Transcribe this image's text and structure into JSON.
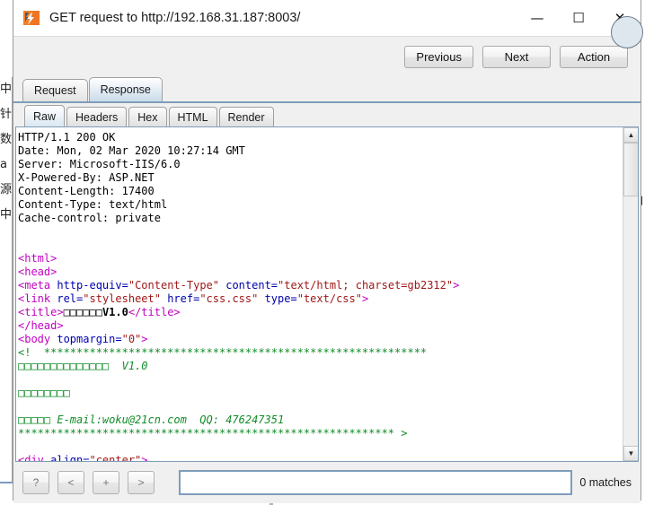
{
  "window": {
    "title": "GET request to http://192.168.31.187:8003/",
    "icon": "burp-suite-icon",
    "minimize": "—",
    "maximize": "☐",
    "close": "✕"
  },
  "toolbar": {
    "previous_label": "Previous",
    "next_label": "Next",
    "action_label": "Action"
  },
  "tabs": [
    {
      "label": "Request",
      "active": false
    },
    {
      "label": "Response",
      "active": true
    }
  ],
  "subtabs": [
    {
      "label": "Raw",
      "active": true
    },
    {
      "label": "Headers",
      "active": false
    },
    {
      "label": "Hex",
      "active": false
    },
    {
      "label": "HTML",
      "active": false
    },
    {
      "label": "Render",
      "active": false
    }
  ],
  "response": {
    "status_line": "HTTP/1.1 200 OK",
    "headers": [
      "Date: Mon, 02 Mar 2020 10:27:14 GMT",
      "Server: Microsoft-IIS/6.0",
      "X-Powered-By: ASP.NET",
      "Content-Length: 17400",
      "Content-Type: text/html",
      "Cache-control: private"
    ],
    "body_lines": [
      {
        "segments": [
          {
            "t": "<html>",
            "c": "tag"
          }
        ]
      },
      {
        "segments": [
          {
            "t": "<head>",
            "c": "tag"
          }
        ]
      },
      {
        "segments": [
          {
            "t": "<meta ",
            "c": "tag"
          },
          {
            "t": "http-equiv=",
            "c": "attr"
          },
          {
            "t": "\"Content-Type\"",
            "c": "val"
          },
          {
            "t": " content=",
            "c": "attr"
          },
          {
            "t": "\"text/html; charset=gb2312\"",
            "c": "val"
          },
          {
            "t": ">",
            "c": "tag"
          }
        ]
      },
      {
        "segments": [
          {
            "t": "<link ",
            "c": "tag"
          },
          {
            "t": "rel=",
            "c": "attr"
          },
          {
            "t": "\"stylesheet\"",
            "c": "val"
          },
          {
            "t": " href=",
            "c": "attr"
          },
          {
            "t": "\"css.css\"",
            "c": "val"
          },
          {
            "t": " type=",
            "c": "attr"
          },
          {
            "t": "\"text/css\"",
            "c": "val"
          },
          {
            "t": ">",
            "c": "tag"
          }
        ]
      },
      {
        "segments": [
          {
            "t": "<title>",
            "c": "tag"
          },
          {
            "t": "□□□□□□",
            "c": "tofu"
          },
          {
            "t": "V1.0",
            "c": "bold"
          },
          {
            "t": "</title>",
            "c": "tag"
          }
        ]
      },
      {
        "segments": [
          {
            "t": "</head>",
            "c": "tag"
          }
        ]
      },
      {
        "segments": [
          {
            "t": "<body ",
            "c": "tag"
          },
          {
            "t": "topmargin=",
            "c": "attr"
          },
          {
            "t": "\"0\"",
            "c": "val"
          },
          {
            "t": ">",
            "c": "tag"
          }
        ]
      },
      {
        "segments": [
          {
            "t": "<!",
            "c": "cmtp"
          },
          {
            "t": "  ***********************************************************",
            "c": "cmt"
          }
        ]
      },
      {
        "segments": [
          {
            "t": "□□□□□□□□□□□□□□  V1.0",
            "c": "cmt"
          }
        ]
      },
      {
        "segments": [
          {
            "t": "",
            "c": "cmt"
          }
        ]
      },
      {
        "segments": [
          {
            "t": "□□□□□□□□",
            "c": "cmt"
          }
        ]
      },
      {
        "segments": [
          {
            "t": "",
            "c": "cmt"
          }
        ]
      },
      {
        "segments": [
          {
            "t": "□□□□□ E-mail:woku@21cn.com  QQ: 476247351",
            "c": "cmt"
          }
        ]
      },
      {
        "segments": [
          {
            "t": "**********************************************************",
            "c": "cmt"
          },
          {
            "t": " >",
            "c": "cmtp"
          }
        ]
      },
      {
        "segments": [
          {
            "t": "",
            "c": "cmt"
          }
        ]
      },
      {
        "segments": [
          {
            "t": "<div ",
            "c": "tag"
          },
          {
            "t": "align=",
            "c": "attr"
          },
          {
            "t": "\"center\"",
            "c": "val"
          },
          {
            "t": ">",
            "c": "tag"
          }
        ]
      }
    ]
  },
  "search": {
    "help_label": "?",
    "prev_label": "<",
    "plus_label": "+",
    "next_label": ">",
    "value": "",
    "placeholder": "",
    "matches_label": "0 matches"
  },
  "background_window": {
    "left_strip_chars": [
      "中",
      "针",
      "数",
      "a",
      "源",
      "中"
    ],
    "right_icons": [
      "❑",
      "↖"
    ]
  },
  "colors": {
    "tag": "#c000c0",
    "attribute": "#0000b0",
    "value": "#a01818",
    "comment": "#128c28",
    "tab_active": "#c9dbea",
    "border_blue": "#7f9db9"
  }
}
